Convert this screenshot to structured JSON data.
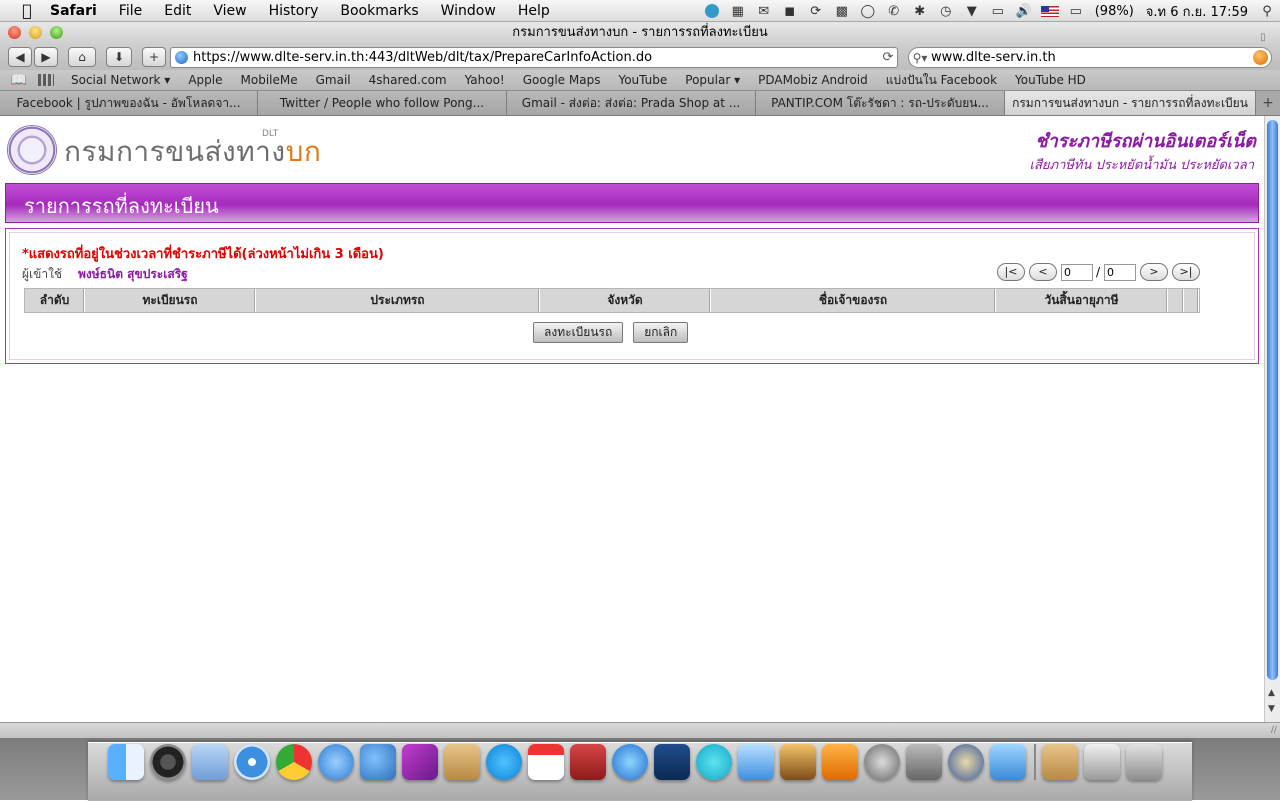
{
  "menubar": {
    "app": "Safari",
    "menus": [
      "File",
      "Edit",
      "View",
      "History",
      "Bookmarks",
      "Window",
      "Help"
    ],
    "battery": "(98%)",
    "datetime": "จ.ท 6 ก.ย. 17:59"
  },
  "window": {
    "title": "กรมการขนส่งทางบก - รายการรถที่ลงทะเบียน"
  },
  "toolbar": {
    "url": "https://www.dlte-serv.in.th:443/dltWeb/dlt/tax/PrepareCarInfoAction.do",
    "search_value": "www.dlte-serv.in.th"
  },
  "bookmarks": [
    "Social Network ▾",
    "Apple",
    "MobileMe",
    "Gmail",
    "4shared.com",
    "Yahoo!",
    "Google Maps",
    "YouTube",
    "Popular ▾",
    "PDAMobiz Android",
    "แบ่งปันใน Facebook",
    "YouTube HD"
  ],
  "tabs": [
    "Facebook | รูปภาพของฉัน - อัพโหลดจา...",
    "Twitter / People who follow Pong...",
    "Gmail - ส่งต่อ: ส่งต่อ: Prada Shop at ...",
    "PANTIP.COM โต๊ะรัชดา : รถ-ประดับยน...",
    "กรมการขนส่งทางบก - รายการรถที่ลงทะเบียน"
  ],
  "page": {
    "logo_text": "กรมการขนส่งทาง",
    "logo_text_accent": "บก",
    "logo_small": "DLT",
    "slogan_main": "ชำระภาษีรถผ่านอินเตอร์เน็ต",
    "slogan_sub": "เสียภาษีทัน ประหยัดน้ำมัน ประหยัดเวลา",
    "banner_title": "รายการรถที่ลงทะเบียน",
    "notice": "*แสดงรถที่อยู่ในช่วงเวลาที่ชำระภาษีได้(ล่วงหน้าไม่เกิน 3 เดือน)",
    "user_label": "ผู้เข้าใช้",
    "user_name": "พงษ์ธนิต สุขประเสริฐ",
    "pager": {
      "first": "|<",
      "prev": "<",
      "current": "0",
      "separator": "/",
      "total": "0",
      "next": ">",
      "last": ">|"
    },
    "table_headers": [
      "ลำดับ",
      "ทะเบียนรถ",
      "ประเภทรถ",
      "จังหวัด",
      "ชื่อเจ้าของรถ",
      "วันสิ้นอายุภาษี"
    ],
    "register_button": "ลงทะเบียนรถ",
    "cancel_button": "ยกเลิก"
  }
}
